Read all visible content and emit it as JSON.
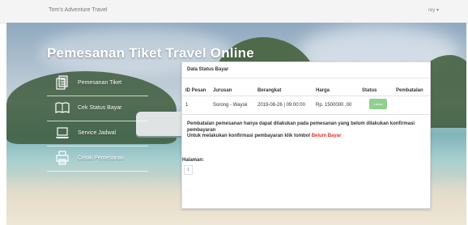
{
  "topbar": {
    "brand": "Tom's Adventure Travel",
    "user": "rey ▾"
  },
  "hero": {
    "title": "Pemesanan Tiket Travel Online"
  },
  "menu": [
    {
      "label": "Pemesanan Tiket",
      "icon": "documents-icon"
    },
    {
      "label": "Cek Status Bayar",
      "icon": "book-icon"
    },
    {
      "label": "Service Jadwal",
      "icon": "laptop-icon"
    },
    {
      "label": "Cetak Pemesanan",
      "icon": "printer-icon"
    }
  ],
  "card": {
    "title": "Data Status Bayar",
    "headers": [
      "ID Pesan",
      "Jurusan",
      "Berangkat",
      "Harga",
      "Status",
      "Pembatalan"
    ],
    "row": {
      "id": "1",
      "jurusan": "Sorong - Waysk",
      "berangkat": "2019-08-26 | 09:00:00",
      "harga": "Rp. 1500000 ,00",
      "status": "Lunas"
    },
    "note_line1": "Pembatalan pemesanan hanya dapat dilakukan pada pemesanan yang belum dilakukan konfirmasi pembayaran",
    "note_line2_prefix": "Untuk melakukan konfirmasi pembayaran klik tombol ",
    "note_line2_link": "Belum Bayar",
    "pager_label": "Halaman:",
    "page": "1"
  },
  "colors": {
    "status_green": "#8fd08f",
    "link_red": "#e0302a"
  }
}
